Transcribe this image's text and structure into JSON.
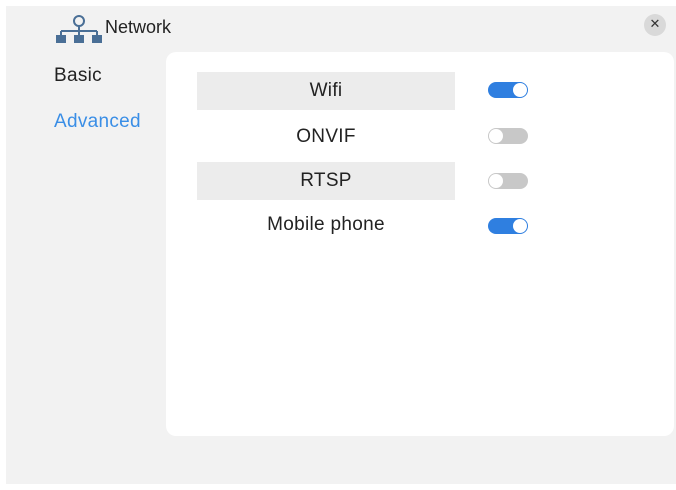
{
  "window": {
    "title": "Network",
    "title_icon": "network-topology-icon",
    "close_icon": "close-icon",
    "close_glyph": "✕"
  },
  "sidebar": {
    "items": [
      {
        "label": "Basic",
        "active": false
      },
      {
        "label": "Advanced",
        "active": true
      }
    ]
  },
  "settings": [
    {
      "label": "Wifi",
      "enabled": true
    },
    {
      "label": "ONVIF",
      "enabled": false
    },
    {
      "label": "RTSP",
      "enabled": false
    },
    {
      "label": "Mobile phone",
      "enabled": true
    }
  ],
  "colors": {
    "accent": "#3a8ee6",
    "toggle_on": "#2f7fe0",
    "toggle_off": "#c8c8c8",
    "background": "#f2f2f2",
    "panel": "#ffffff"
  }
}
